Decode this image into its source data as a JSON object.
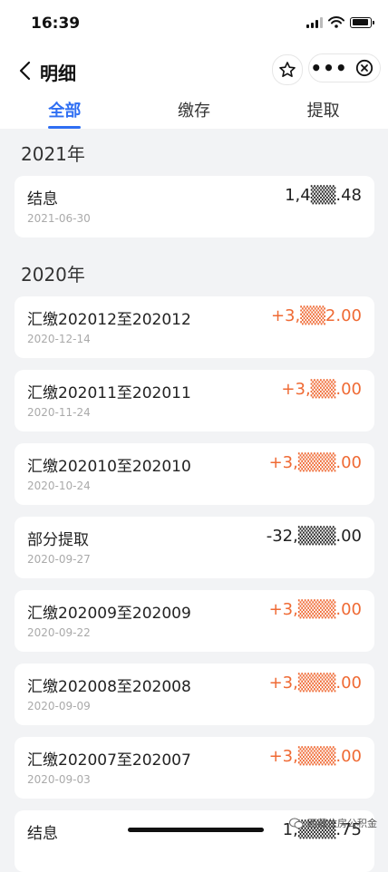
{
  "status": {
    "time": "16:39"
  },
  "nav": {
    "title": "明细",
    "more": "•••"
  },
  "tabs": [
    {
      "label": "全部",
      "active": true
    },
    {
      "label": "缴存",
      "active": false
    },
    {
      "label": "提取",
      "active": false
    }
  ],
  "groups": [
    {
      "year": "2021年",
      "records": [
        {
          "name": "结息",
          "date": "2021-06-30",
          "amount": "1,4▒▒.48",
          "positive": false
        }
      ]
    },
    {
      "year": "2020年",
      "records": [
        {
          "name": "汇缴202012至202012",
          "date": "2020-12-14",
          "amount": "+3,▒▒2.00",
          "positive": true
        },
        {
          "name": "汇缴202011至202011",
          "date": "2020-11-24",
          "amount": "+3,▒▒.00",
          "positive": true
        },
        {
          "name": "汇缴202010至202010",
          "date": "2020-10-24",
          "amount": "+3,▒▒▒.00",
          "positive": true
        },
        {
          "name": "部分提取",
          "date": "2020-09-27",
          "amount": "-32,▒▒▒.00",
          "positive": false
        },
        {
          "name": "汇缴202009至202009",
          "date": "2020-09-22",
          "amount": "+3,▒▒▒.00",
          "positive": true
        },
        {
          "name": "汇缴202008至202008",
          "date": "2020-09-09",
          "amount": "+3,▒▒▒.00",
          "positive": true
        },
        {
          "name": "汇缴202007至202007",
          "date": "2020-09-03",
          "amount": "+3,▒▒▒.00",
          "positive": true
        },
        {
          "name": "结息",
          "date": "",
          "amount": "1,▒▒▒.75",
          "positive": false
        }
      ]
    }
  ],
  "watermark": "西藏住房公积金",
  "colors": {
    "accent": "#2f6ff3",
    "positive": "#ef6a34",
    "background": "#f2f3f5"
  }
}
